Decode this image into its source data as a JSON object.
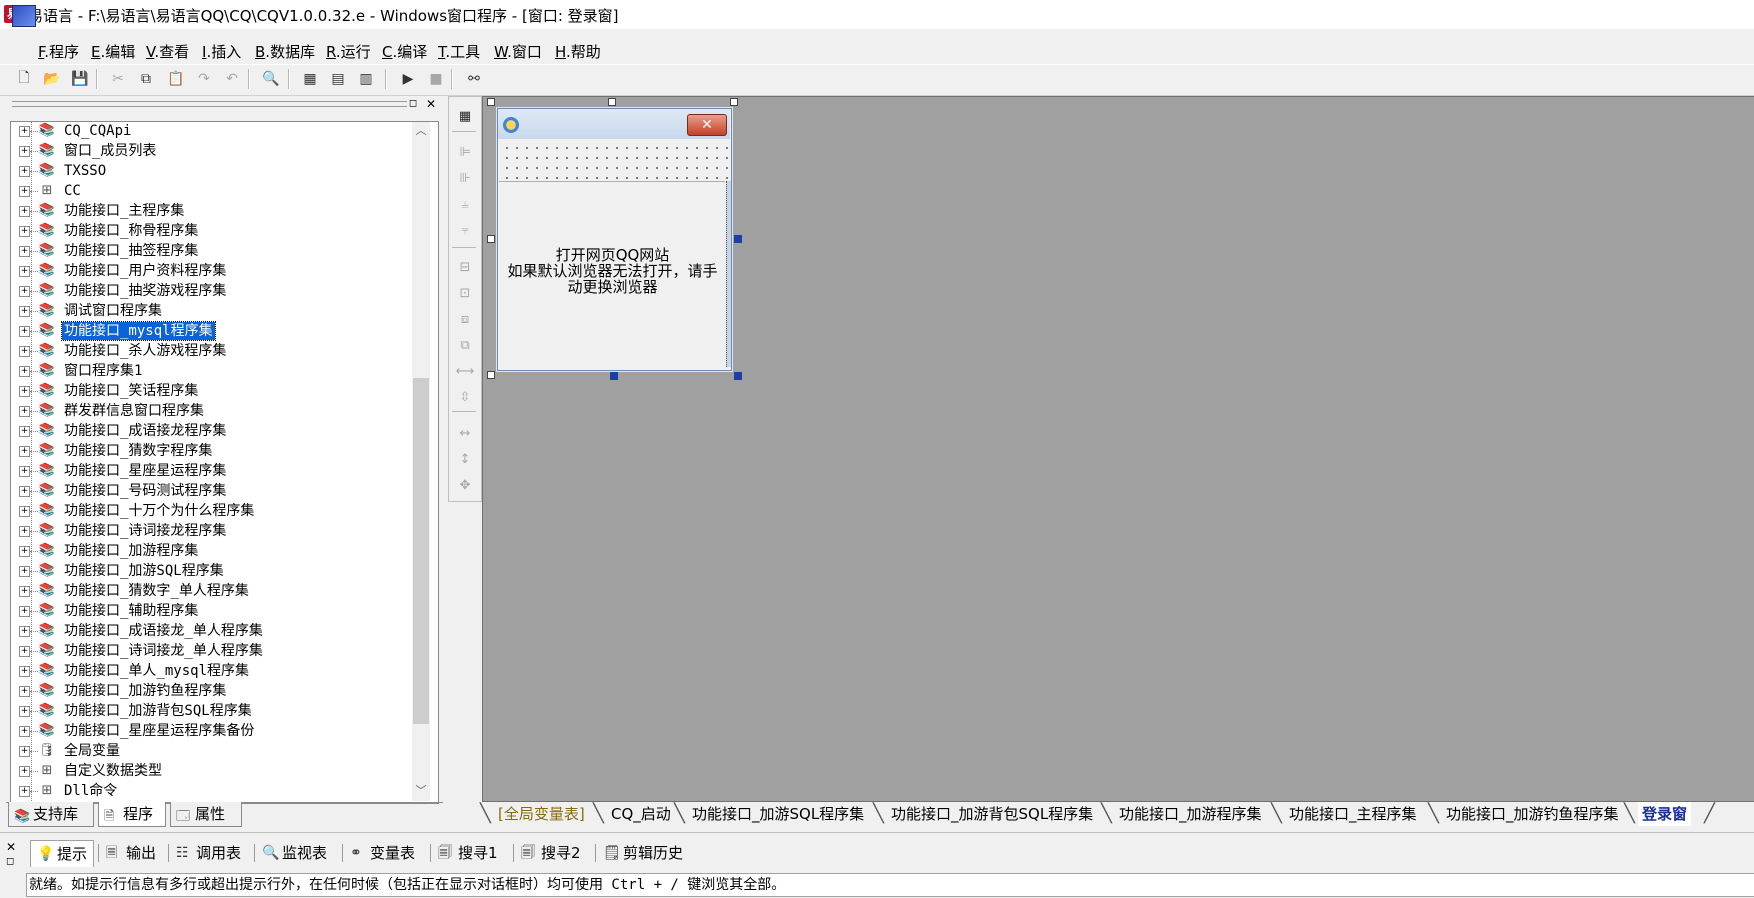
{
  "window": {
    "title": "易语言 - F:\\易语言\\易语言QQ\\CQ\\CQV1.0.0.32.e - Windows窗口程序 - [窗口: 登录窗]"
  },
  "menu": [
    {
      "key": "F",
      "label": ".程序"
    },
    {
      "key": "E",
      "label": ".编辑"
    },
    {
      "key": "V",
      "label": ".查看"
    },
    {
      "key": "I",
      "label": ".插入"
    },
    {
      "key": "B",
      "label": ".数据库"
    },
    {
      "key": "R",
      "label": ".运行"
    },
    {
      "key": "C",
      "label": ".编译"
    },
    {
      "key": "T",
      "label": ".工具"
    },
    {
      "key": "W",
      "label": ".窗口"
    },
    {
      "key": "H",
      "label": ".帮助"
    }
  ],
  "toolbar": [
    {
      "icon": "new-file-icon",
      "glyph": "🗋",
      "enabled": true
    },
    {
      "icon": "open-folder-icon",
      "glyph": "📂",
      "enabled": true
    },
    {
      "icon": "save-icon",
      "glyph": "💾",
      "enabled": true
    },
    {
      "icon": "cut-icon",
      "glyph": "✂",
      "enabled": false
    },
    {
      "icon": "copy-icon",
      "glyph": "⧉",
      "enabled": true
    },
    {
      "icon": "paste-icon",
      "glyph": "📋",
      "enabled": false
    },
    {
      "icon": "redo-icon",
      "glyph": "↷",
      "enabled": false
    },
    {
      "icon": "undo-icon",
      "glyph": "↶",
      "enabled": false
    },
    {
      "icon": "find-icon",
      "glyph": "🔍",
      "enabled": true
    },
    {
      "icon": "layout-1-icon",
      "glyph": "▦",
      "enabled": true
    },
    {
      "icon": "layout-2-icon",
      "glyph": "▤",
      "enabled": true
    },
    {
      "icon": "layout-3-icon",
      "glyph": "▥",
      "enabled": true
    },
    {
      "icon": "run-icon",
      "glyph": "▶",
      "enabled": true
    },
    {
      "icon": "stop-icon",
      "glyph": "■",
      "enabled": false
    },
    {
      "icon": "binoculars-icon",
      "glyph": "⚯",
      "enabled": true
    }
  ],
  "tree": {
    "selected_index": 10,
    "items": [
      {
        "label": "CQ_CQApi",
        "icon": "book"
      },
      {
        "label": "窗口_成员列表",
        "icon": "book"
      },
      {
        "label": "TXSSO",
        "icon": "book"
      },
      {
        "label": "CC",
        "icon": "struct"
      },
      {
        "label": "功能接口_主程序集",
        "icon": "book"
      },
      {
        "label": "功能接口_称骨程序集",
        "icon": "book"
      },
      {
        "label": "功能接口_抽签程序集",
        "icon": "book"
      },
      {
        "label": "功能接口_用户资料程序集",
        "icon": "book"
      },
      {
        "label": "功能接口_抽奖游戏程序集",
        "icon": "book"
      },
      {
        "label": "调试窗口程序集",
        "icon": "book"
      },
      {
        "label": "功能接口_mysql程序集",
        "icon": "book"
      },
      {
        "label": "功能接口_杀人游戏程序集",
        "icon": "book"
      },
      {
        "label": "窗口程序集1",
        "icon": "book"
      },
      {
        "label": "功能接口_笑话程序集",
        "icon": "book"
      },
      {
        "label": "群发群信息窗口程序集",
        "icon": "book"
      },
      {
        "label": "功能接口_成语接龙程序集",
        "icon": "book"
      },
      {
        "label": "功能接口_猜数字程序集",
        "icon": "book"
      },
      {
        "label": "功能接口_星座星运程序集",
        "icon": "book"
      },
      {
        "label": "功能接口_号码测试程序集",
        "icon": "book"
      },
      {
        "label": "功能接口_十万个为什么程序集",
        "icon": "book"
      },
      {
        "label": "功能接口_诗词接龙程序集",
        "icon": "book"
      },
      {
        "label": "功能接口_加游程序集",
        "icon": "book"
      },
      {
        "label": "功能接口_加游SQL程序集",
        "icon": "book"
      },
      {
        "label": "功能接口_猜数字_单人程序集",
        "icon": "book"
      },
      {
        "label": "功能接口_辅助程序集",
        "icon": "book"
      },
      {
        "label": "功能接口_成语接龙_单人程序集",
        "icon": "book"
      },
      {
        "label": "功能接口_诗词接龙_单人程序集",
        "icon": "book"
      },
      {
        "label": "功能接口_单人_mysql程序集",
        "icon": "book"
      },
      {
        "label": "功能接口_加游钓鱼程序集",
        "icon": "book"
      },
      {
        "label": "功能接口_加游背包SQL程序集",
        "icon": "book"
      },
      {
        "label": "功能接口_星座星运程序集备份",
        "icon": "book"
      },
      {
        "label": "全局变量",
        "icon": "globe"
      },
      {
        "label": "自定义数据类型",
        "icon": "struct"
      },
      {
        "label": "Dll命令",
        "icon": "struct"
      }
    ]
  },
  "left_tabs": [
    {
      "label": "支持库",
      "icon": "library-icon",
      "glyph": "📚"
    },
    {
      "label": "程序",
      "icon": "program-icon",
      "glyph": "🗎"
    },
    {
      "label": "属性",
      "icon": "properties-icon",
      "glyph": "🗔"
    }
  ],
  "form": {
    "text_line1": "打开网页QQ网站",
    "text_line2": "如果默认浏览器无法打开，请手",
    "text_line3": "动更换浏览器"
  },
  "file_tabs": [
    "[全局变量表]",
    "CQ_启动",
    "功能接口_加游SQL程序集",
    "功能接口_加游背包SQL程序集",
    "功能接口_加游程序集",
    "功能接口_主程序集",
    "功能接口_加游钓鱼程序集",
    "登录窗"
  ],
  "output_tabs": [
    {
      "label": "提示",
      "glyph": "💡"
    },
    {
      "label": "输出",
      "glyph": "🗏"
    },
    {
      "label": "调用表",
      "glyph": "☷"
    },
    {
      "label": "监视表",
      "glyph": "🔍"
    },
    {
      "label": "变量表",
      "glyph": "⚭"
    },
    {
      "label": "搜寻1",
      "glyph": "🗐"
    },
    {
      "label": "搜寻2",
      "glyph": "🗐"
    },
    {
      "label": "剪辑历史",
      "glyph": "🗒"
    }
  ],
  "status_text": "就绪。如提示行信息有多行或超出提示行外，在任何时候（包括正在显示对话框时）均可使用 Ctrl + / 键浏览其全部。",
  "colors": {
    "selection": "#0a64d8",
    "design_bg": "#a0a0a0",
    "active_tab_text": "#1a2f9a"
  }
}
